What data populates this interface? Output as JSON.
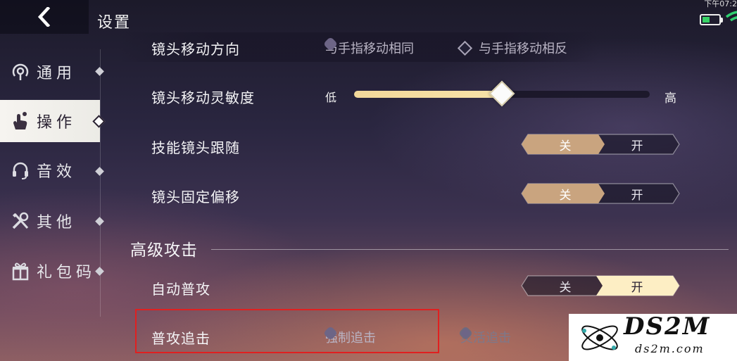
{
  "header": {
    "title": "设置",
    "status_time": "下午07:2"
  },
  "sidebar": {
    "items": [
      {
        "label": "通用",
        "icon": "radio-signal-icon"
      },
      {
        "label": "操作",
        "icon": "touch-hand-icon",
        "active": true
      },
      {
        "label": "音效",
        "icon": "headset-icon"
      },
      {
        "label": "其他",
        "icon": "tools-icon"
      },
      {
        "label": "礼包码",
        "icon": "gift-icon"
      }
    ]
  },
  "camera_direction": {
    "label": "镜头移动方向",
    "options": [
      "与手指移动相同",
      "与手指移动相反"
    ]
  },
  "camera_sensitivity": {
    "label": "镜头移动灵敏度",
    "low": "低",
    "high": "高",
    "value": 0.5
  },
  "skill_camera_follow": {
    "label": "技能镜头跟随",
    "off": "关",
    "on": "开",
    "selected": "off"
  },
  "camera_fixed_offset": {
    "label": "镜头固定偏移",
    "off": "关",
    "on": "开",
    "selected": "off"
  },
  "section": {
    "title": "高级攻击"
  },
  "auto_attack": {
    "label": "自动普攻",
    "off": "关",
    "on": "开",
    "selected": "on"
  },
  "attack_chase": {
    "label": "普攻追击",
    "options": [
      "强制追击",
      "灵活追击"
    ]
  },
  "watermark": {
    "brand": "DS2M",
    "url": "ds2m.com"
  },
  "colors": {
    "toggle_off_selected": "#c9a47f",
    "toggle_on_selected": "#fdeec4",
    "highlight_box": "#e02020"
  }
}
